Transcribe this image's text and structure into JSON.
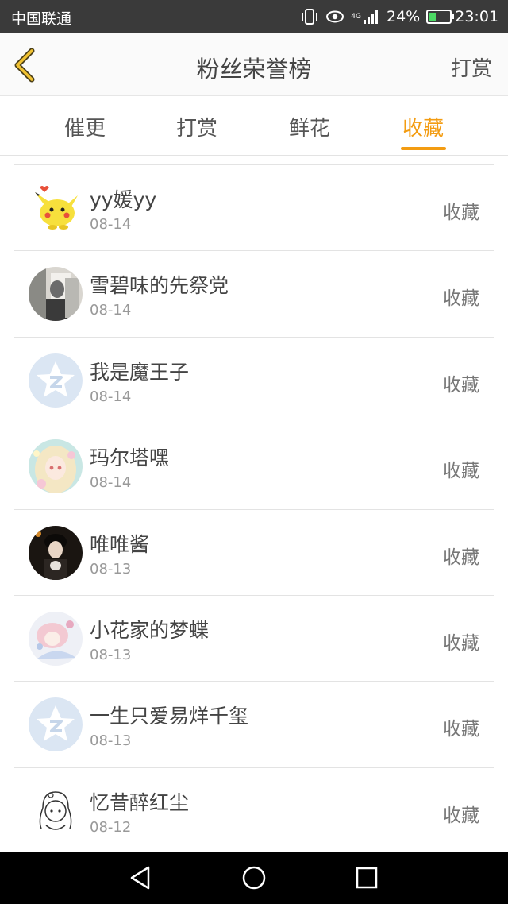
{
  "status_bar": {
    "carrier": "中国联通",
    "network": "4G",
    "battery": "24%",
    "time": "23:01"
  },
  "header": {
    "title": "粉丝荣誉榜",
    "action": "打赏",
    "back_icon": "chevron-left-icon"
  },
  "tabs": [
    {
      "label": "催更",
      "active": false
    },
    {
      "label": "打赏",
      "active": false
    },
    {
      "label": "鲜花",
      "active": false
    },
    {
      "label": "收藏",
      "active": true
    }
  ],
  "colors": {
    "accent": "#f39c12",
    "status_bar": "#3a3a3a",
    "text": "#444444",
    "muted": "#999999"
  },
  "list": [
    {
      "name": "yy媛yy",
      "date": "08-14",
      "type": "收藏",
      "avatar": "pikachu"
    },
    {
      "name": "雪碧味的先祭党",
      "date": "08-14",
      "type": "收藏",
      "avatar": "photo"
    },
    {
      "name": "我是魔王子",
      "date": "08-14",
      "type": "收藏",
      "avatar": "default-star"
    },
    {
      "name": "玛尔塔嘿",
      "date": "08-14",
      "type": "收藏",
      "avatar": "anime-girl"
    },
    {
      "name": "唯唯酱",
      "date": "08-13",
      "type": "收藏",
      "avatar": "dark-portrait"
    },
    {
      "name": "小花家的梦蝶",
      "date": "08-13",
      "type": "收藏",
      "avatar": "anime-pink"
    },
    {
      "name": "一生只爱易烊千玺",
      "date": "08-13",
      "type": "收藏",
      "avatar": "default-star"
    },
    {
      "name": "忆昔醉红尘",
      "date": "08-12",
      "type": "收藏",
      "avatar": "sketch-girl"
    }
  ],
  "nav": {
    "back": "triangle-back-icon",
    "home": "circle-home-icon",
    "recent": "square-recent-icon"
  }
}
